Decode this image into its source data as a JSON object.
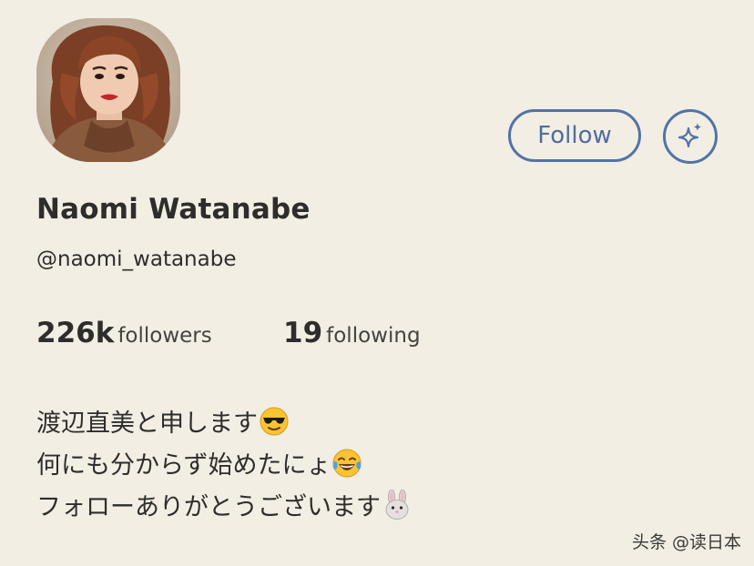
{
  "profile": {
    "name": "Naomi Watanabe",
    "handle": "@naomi_watanabe",
    "follow_label": "Follow",
    "stats": {
      "followers_count": "226k",
      "followers_label": "followers",
      "following_count": "19",
      "following_label": "following"
    },
    "bio": [
      "渡辺直美と申します",
      "何にも分からず始めたにょ",
      "フォローありがとうございます"
    ]
  },
  "watermark": "头条 @读日本",
  "colors": {
    "background": "#f2eee4",
    "accent": "#5273a7",
    "text": "#2e2d2b"
  }
}
